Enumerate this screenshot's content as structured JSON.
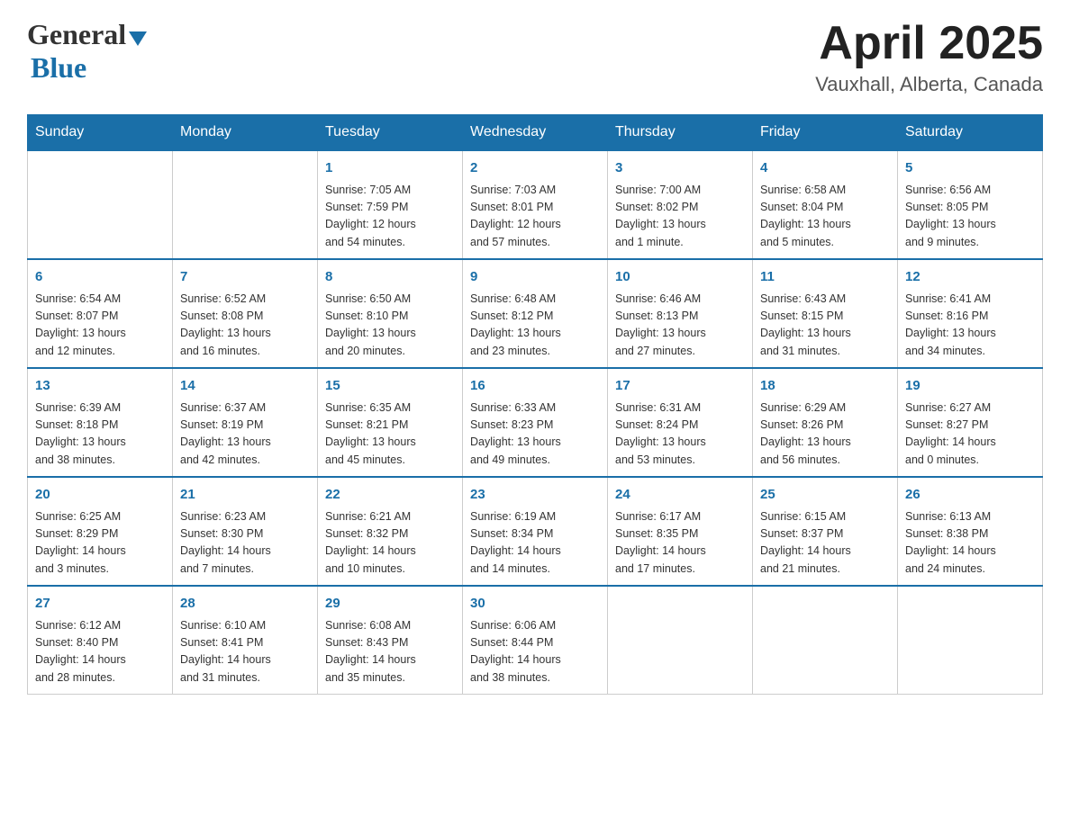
{
  "header": {
    "logo_general": "General",
    "logo_blue": "Blue",
    "title": "April 2025",
    "subtitle": "Vauxhall, Alberta, Canada"
  },
  "weekdays": [
    "Sunday",
    "Monday",
    "Tuesday",
    "Wednesday",
    "Thursday",
    "Friday",
    "Saturday"
  ],
  "weeks": [
    [
      {
        "day": "",
        "info": ""
      },
      {
        "day": "",
        "info": ""
      },
      {
        "day": "1",
        "info": "Sunrise: 7:05 AM\nSunset: 7:59 PM\nDaylight: 12 hours\nand 54 minutes."
      },
      {
        "day": "2",
        "info": "Sunrise: 7:03 AM\nSunset: 8:01 PM\nDaylight: 12 hours\nand 57 minutes."
      },
      {
        "day": "3",
        "info": "Sunrise: 7:00 AM\nSunset: 8:02 PM\nDaylight: 13 hours\nand 1 minute."
      },
      {
        "day": "4",
        "info": "Sunrise: 6:58 AM\nSunset: 8:04 PM\nDaylight: 13 hours\nand 5 minutes."
      },
      {
        "day": "5",
        "info": "Sunrise: 6:56 AM\nSunset: 8:05 PM\nDaylight: 13 hours\nand 9 minutes."
      }
    ],
    [
      {
        "day": "6",
        "info": "Sunrise: 6:54 AM\nSunset: 8:07 PM\nDaylight: 13 hours\nand 12 minutes."
      },
      {
        "day": "7",
        "info": "Sunrise: 6:52 AM\nSunset: 8:08 PM\nDaylight: 13 hours\nand 16 minutes."
      },
      {
        "day": "8",
        "info": "Sunrise: 6:50 AM\nSunset: 8:10 PM\nDaylight: 13 hours\nand 20 minutes."
      },
      {
        "day": "9",
        "info": "Sunrise: 6:48 AM\nSunset: 8:12 PM\nDaylight: 13 hours\nand 23 minutes."
      },
      {
        "day": "10",
        "info": "Sunrise: 6:46 AM\nSunset: 8:13 PM\nDaylight: 13 hours\nand 27 minutes."
      },
      {
        "day": "11",
        "info": "Sunrise: 6:43 AM\nSunset: 8:15 PM\nDaylight: 13 hours\nand 31 minutes."
      },
      {
        "day": "12",
        "info": "Sunrise: 6:41 AM\nSunset: 8:16 PM\nDaylight: 13 hours\nand 34 minutes."
      }
    ],
    [
      {
        "day": "13",
        "info": "Sunrise: 6:39 AM\nSunset: 8:18 PM\nDaylight: 13 hours\nand 38 minutes."
      },
      {
        "day": "14",
        "info": "Sunrise: 6:37 AM\nSunset: 8:19 PM\nDaylight: 13 hours\nand 42 minutes."
      },
      {
        "day": "15",
        "info": "Sunrise: 6:35 AM\nSunset: 8:21 PM\nDaylight: 13 hours\nand 45 minutes."
      },
      {
        "day": "16",
        "info": "Sunrise: 6:33 AM\nSunset: 8:23 PM\nDaylight: 13 hours\nand 49 minutes."
      },
      {
        "day": "17",
        "info": "Sunrise: 6:31 AM\nSunset: 8:24 PM\nDaylight: 13 hours\nand 53 minutes."
      },
      {
        "day": "18",
        "info": "Sunrise: 6:29 AM\nSunset: 8:26 PM\nDaylight: 13 hours\nand 56 minutes."
      },
      {
        "day": "19",
        "info": "Sunrise: 6:27 AM\nSunset: 8:27 PM\nDaylight: 14 hours\nand 0 minutes."
      }
    ],
    [
      {
        "day": "20",
        "info": "Sunrise: 6:25 AM\nSunset: 8:29 PM\nDaylight: 14 hours\nand 3 minutes."
      },
      {
        "day": "21",
        "info": "Sunrise: 6:23 AM\nSunset: 8:30 PM\nDaylight: 14 hours\nand 7 minutes."
      },
      {
        "day": "22",
        "info": "Sunrise: 6:21 AM\nSunset: 8:32 PM\nDaylight: 14 hours\nand 10 minutes."
      },
      {
        "day": "23",
        "info": "Sunrise: 6:19 AM\nSunset: 8:34 PM\nDaylight: 14 hours\nand 14 minutes."
      },
      {
        "day": "24",
        "info": "Sunrise: 6:17 AM\nSunset: 8:35 PM\nDaylight: 14 hours\nand 17 minutes."
      },
      {
        "day": "25",
        "info": "Sunrise: 6:15 AM\nSunset: 8:37 PM\nDaylight: 14 hours\nand 21 minutes."
      },
      {
        "day": "26",
        "info": "Sunrise: 6:13 AM\nSunset: 8:38 PM\nDaylight: 14 hours\nand 24 minutes."
      }
    ],
    [
      {
        "day": "27",
        "info": "Sunrise: 6:12 AM\nSunset: 8:40 PM\nDaylight: 14 hours\nand 28 minutes."
      },
      {
        "day": "28",
        "info": "Sunrise: 6:10 AM\nSunset: 8:41 PM\nDaylight: 14 hours\nand 31 minutes."
      },
      {
        "day": "29",
        "info": "Sunrise: 6:08 AM\nSunset: 8:43 PM\nDaylight: 14 hours\nand 35 minutes."
      },
      {
        "day": "30",
        "info": "Sunrise: 6:06 AM\nSunset: 8:44 PM\nDaylight: 14 hours\nand 38 minutes."
      },
      {
        "day": "",
        "info": ""
      },
      {
        "day": "",
        "info": ""
      },
      {
        "day": "",
        "info": ""
      }
    ]
  ]
}
